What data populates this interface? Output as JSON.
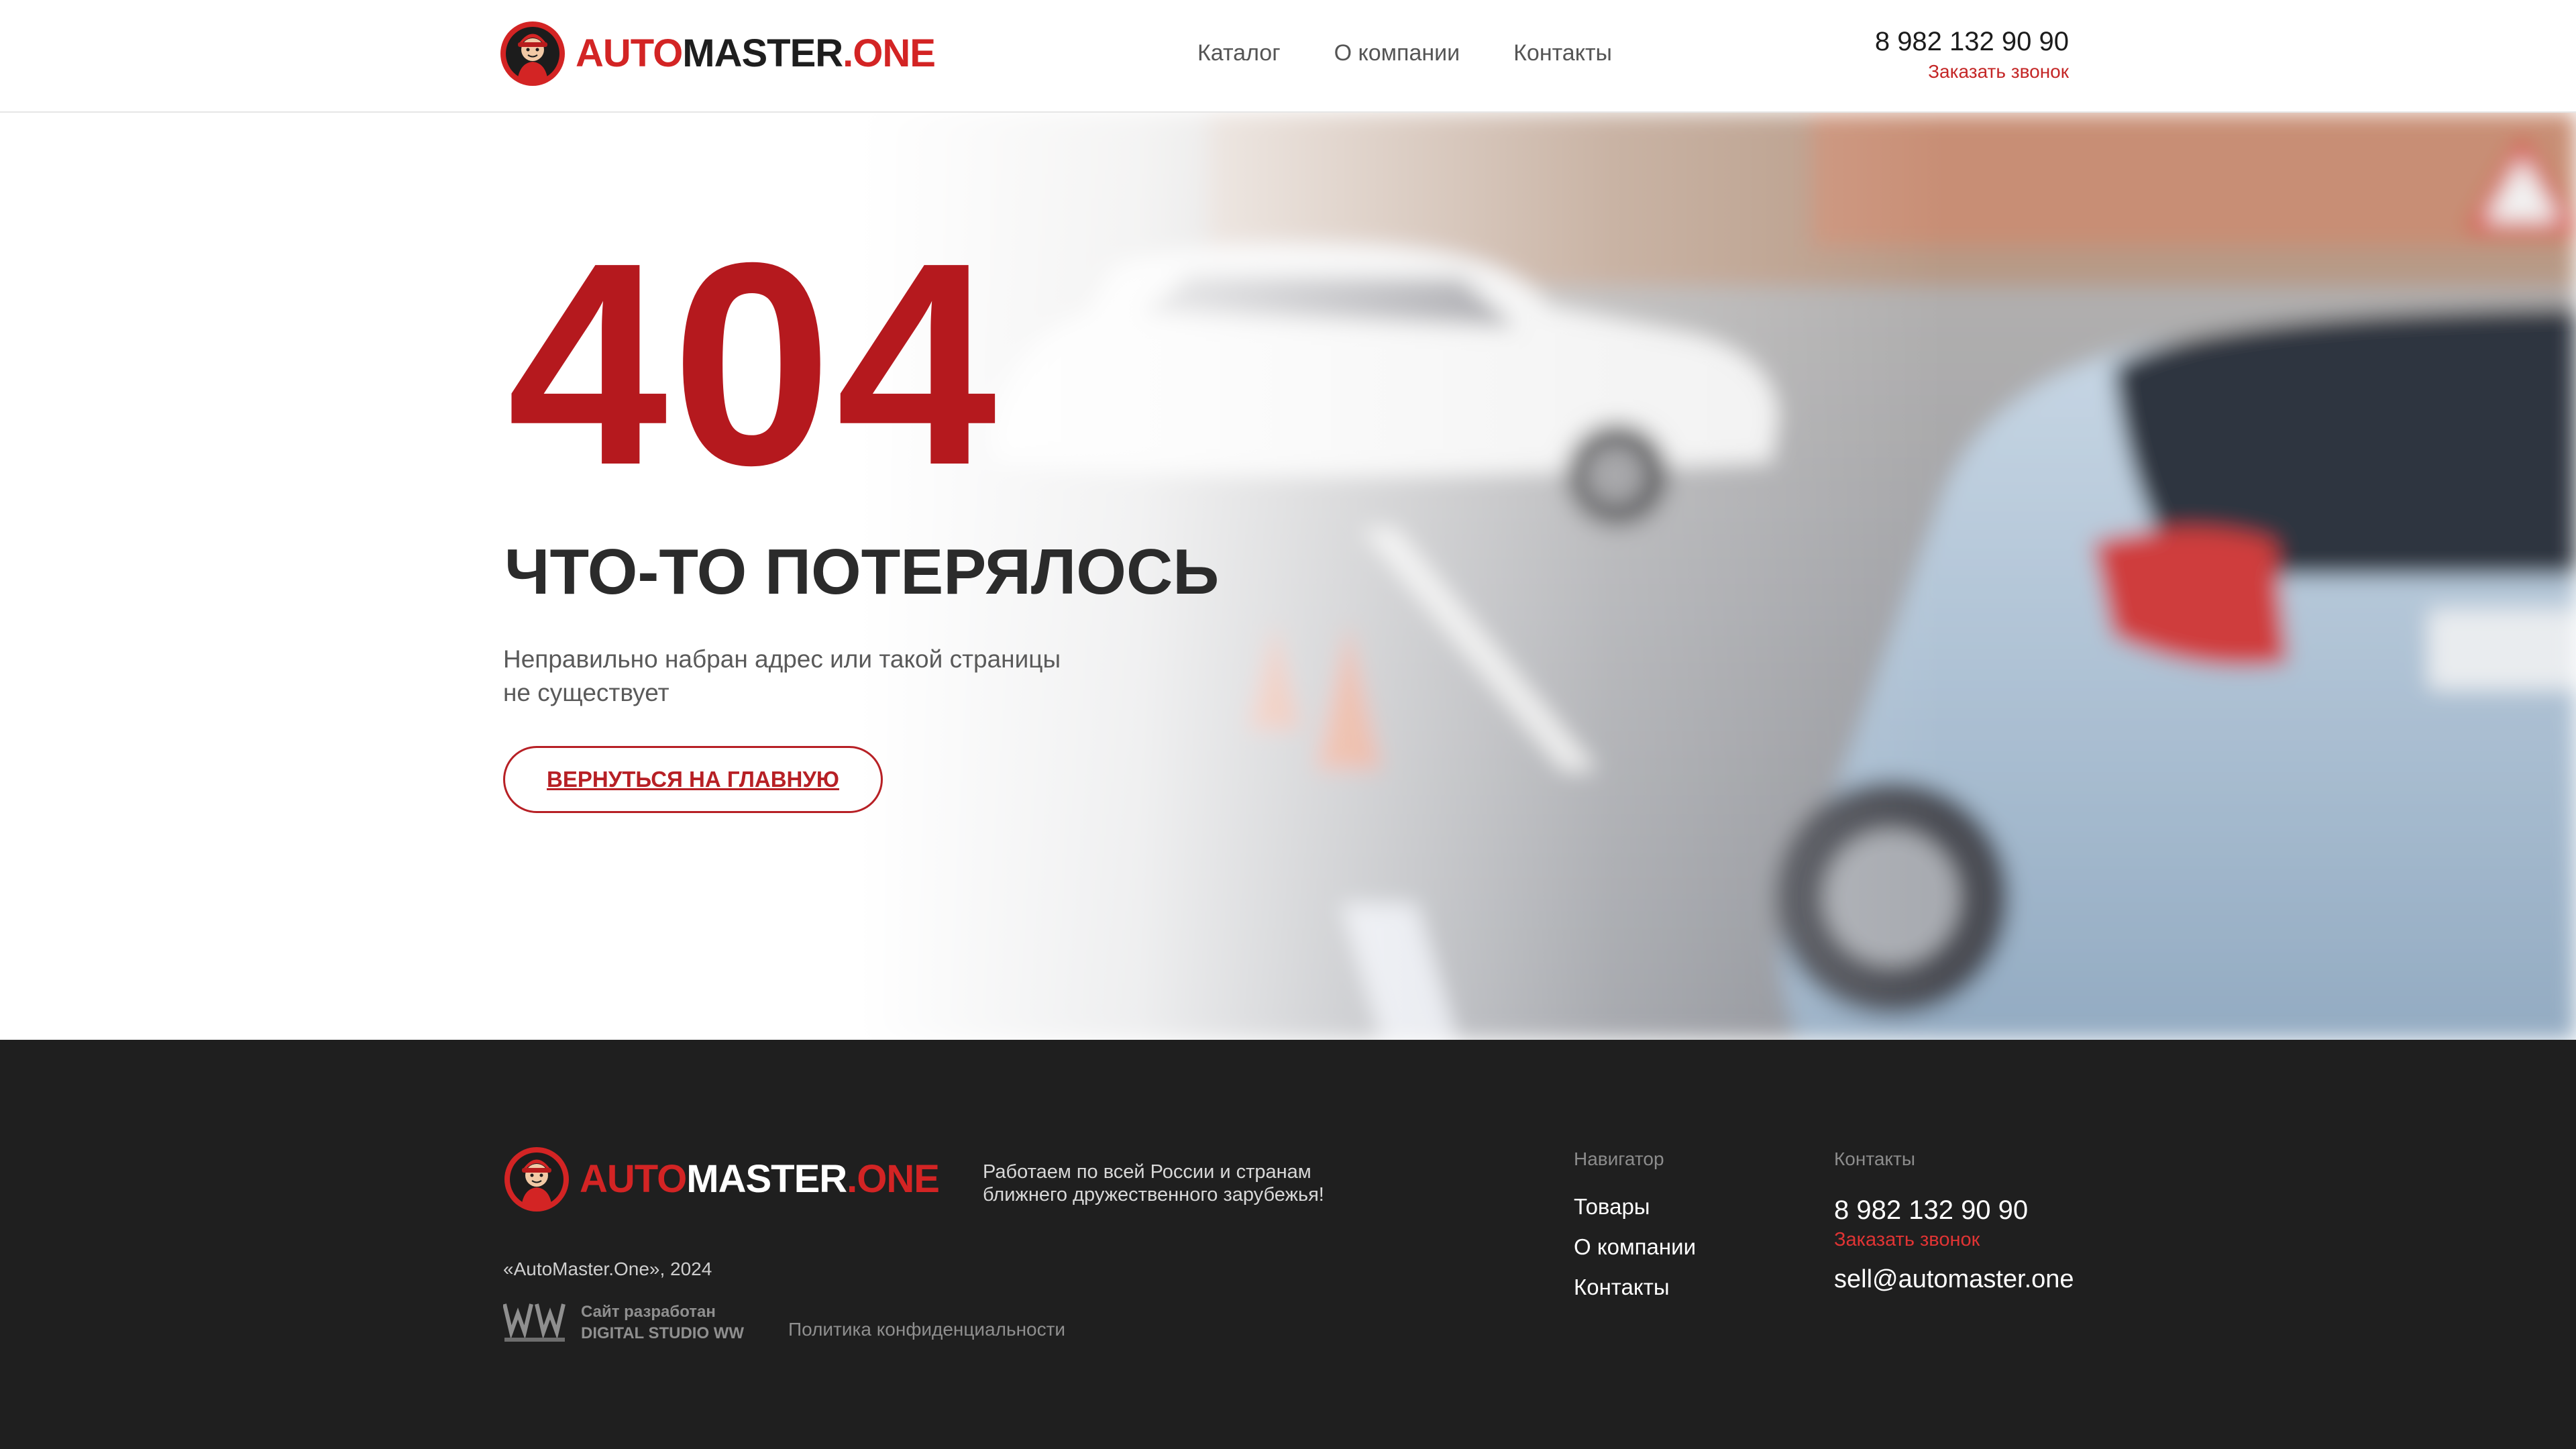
{
  "header": {
    "logo": {
      "part1": "AUTO",
      "part2": "MASTER",
      "part3": ".ONE"
    },
    "nav": [
      "Каталог",
      "О компании",
      "Контакты"
    ],
    "phone": "8 982 132 90 90",
    "callback": "Заказать звонок"
  },
  "hero": {
    "code": "404",
    "title": "ЧТО-ТО ПОТЕРЯЛОСЬ",
    "desc_line1": "Неправильно набран адрес или такой страницы",
    "desc_line2": "не существует",
    "button": "ВЕРНУТЬСЯ НА ГЛАВНУЮ"
  },
  "footer": {
    "logo": {
      "part1": "AUTO",
      "part2": "MASTER",
      "part3": ".ONE"
    },
    "tagline_line1": "Работаем по всей России и странам",
    "tagline_line2": "ближнего дружественного зарубежья!",
    "copyright": "«AutoMaster.One», 2024",
    "studio_line1": "Сайт разработан",
    "studio_line2": "DIGITAL STUDIO WW",
    "policy": "Политика конфиденциальности",
    "nav_title": "Навигатор",
    "nav": [
      "Товары",
      "О компании",
      "Контакты"
    ],
    "contacts_title": "Контакты",
    "phone": "8 982 132 90 90",
    "callback": "Заказать звонок",
    "email": "sell@automaster.one"
  },
  "colors": {
    "brand_red": "#d32424",
    "dark_red": "#b5191e",
    "footer_bg": "#1f1f1f"
  }
}
